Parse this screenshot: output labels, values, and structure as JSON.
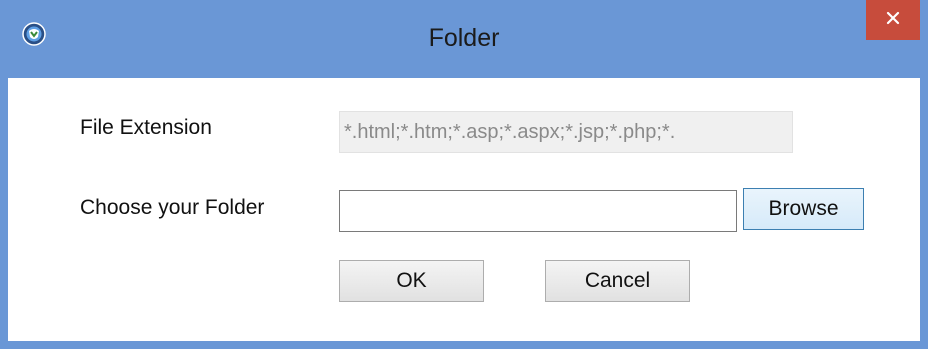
{
  "window": {
    "title": "Folder",
    "app_icon": "globe-shield-icon",
    "close_icon": "close-icon",
    "titlebar_color": "#6a97d6",
    "close_color": "#c74c3c"
  },
  "form": {
    "file_extension_label": "File Extension",
    "file_extension_value": "*.html;*.htm;*.asp;*.aspx;*.jsp;*.php;*.",
    "folder_label": "Choose your Folder",
    "folder_value": "",
    "browse_label": "Browse"
  },
  "actions": {
    "ok_label": "OK",
    "cancel_label": "Cancel"
  }
}
